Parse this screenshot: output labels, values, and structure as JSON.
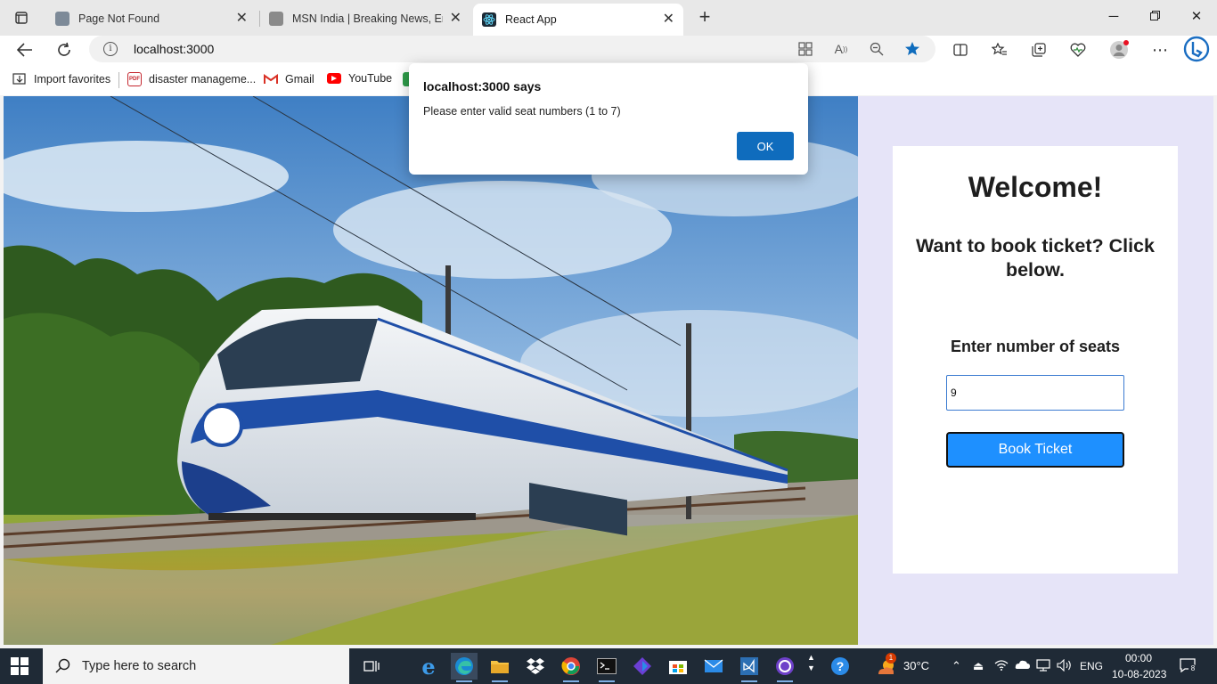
{
  "browser": {
    "tabs": [
      {
        "title": "Page Not Found",
        "active": false
      },
      {
        "title": "MSN India | Breaking News, Ente",
        "active": false
      },
      {
        "title": "React App",
        "active": true
      }
    ],
    "address": "localhost:3000",
    "favorites": [
      {
        "label": "Import favorites",
        "icon": "import-icon"
      },
      {
        "label": "disaster manageme...",
        "icon": "pdf-icon"
      },
      {
        "label": "Gmail",
        "icon": "gmail-icon"
      },
      {
        "label": "YouTube",
        "icon": "youtube-icon"
      }
    ]
  },
  "alert": {
    "title": "localhost:3000 says",
    "message": "Please enter valid seat numbers (1 to 7)",
    "ok_label": "OK"
  },
  "page": {
    "welcome": "Welcome!",
    "subtitle": "Want to book ticket? Click below.",
    "seats_label": "Enter number of seats",
    "seats_value": "9",
    "book_button": "Book Ticket",
    "panel_background": "#e6e4f8",
    "button_color": "#1e90ff"
  },
  "taskbar": {
    "search_placeholder": "Type here to search",
    "weather": "30°C",
    "weather_badge": "1",
    "language": "ENG",
    "time": "00:00",
    "date": "10-08-2023",
    "notifications": "8"
  }
}
